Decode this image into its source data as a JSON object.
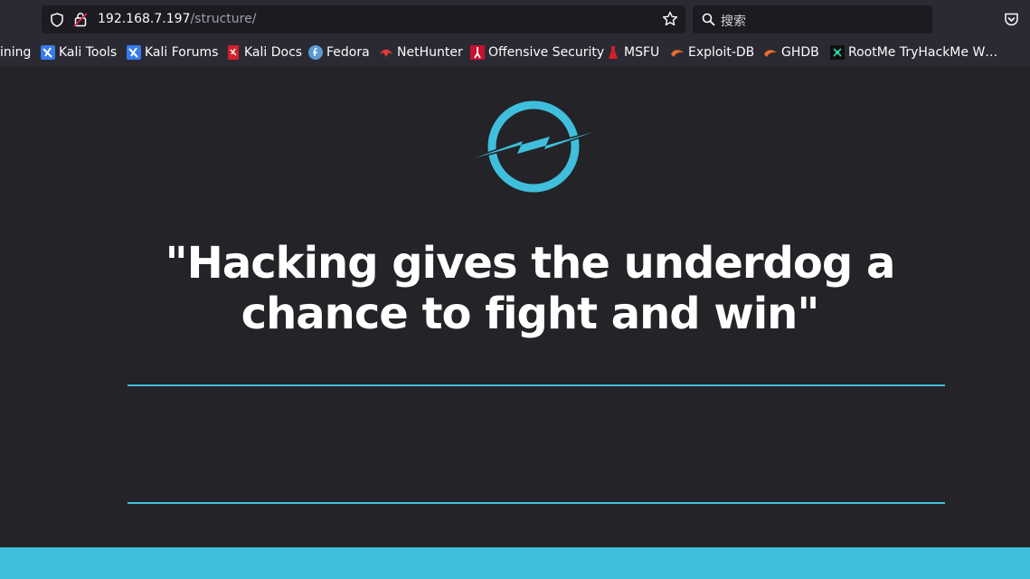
{
  "browser": {
    "url_host": "192.168.7.197",
    "url_path": "/structure/",
    "search_placeholder": "搜索",
    "bookmarks": [
      {
        "label": "ining",
        "icon": "none"
      },
      {
        "label": "Kali Tools",
        "icon": "kali-icon"
      },
      {
        "label": "Kali Forums",
        "icon": "kali-icon"
      },
      {
        "label": "Kali Docs",
        "icon": "kali-docs-icon"
      },
      {
        "label": "Fedora",
        "icon": "fedora-icon"
      },
      {
        "label": "NetHunter",
        "icon": "nethunter-icon"
      },
      {
        "label": "Offensive Security",
        "icon": "offsec-icon"
      },
      {
        "label": "MSFU",
        "icon": "msfu-icon"
      },
      {
        "label": "Exploit-DB",
        "icon": "exploitdb-icon"
      },
      {
        "label": "GHDB",
        "icon": "ghdb-icon"
      },
      {
        "label": "RootMe TryHackMe W…",
        "icon": "rootme-icon"
      }
    ]
  },
  "page": {
    "quote_line1": "\"Hacking gives the underdog a",
    "quote_line2": "chance to fight and win\""
  },
  "colors": {
    "accent": "#3fbfdb",
    "background": "#232328",
    "chrome": "#2b2a33"
  }
}
